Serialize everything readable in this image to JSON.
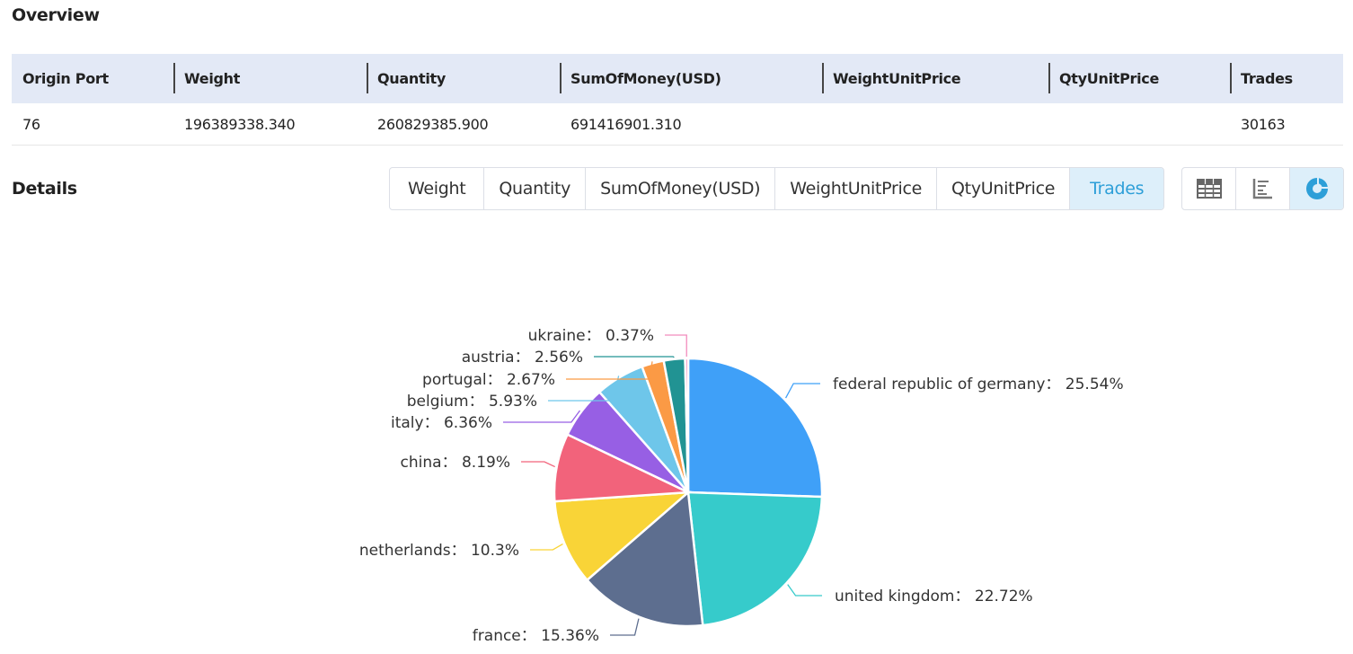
{
  "overview": {
    "title": "Overview",
    "columns": [
      "Origin Port",
      "Weight",
      "Quantity",
      "SumOfMoney(USD)",
      "WeightUnitPrice",
      "QtyUnitPrice",
      "Trades"
    ],
    "row": [
      "76",
      "196389338.340",
      "260829385.900",
      "691416901.310",
      "",
      "",
      "30163"
    ]
  },
  "details": {
    "title": "Details",
    "tabs": [
      {
        "label": "Weight",
        "active": false
      },
      {
        "label": "Quantity",
        "active": false
      },
      {
        "label": "SumOfMoney(USD)",
        "active": false
      },
      {
        "label": "WeightUnitPrice",
        "active": false
      },
      {
        "label": "QtyUnitPrice",
        "active": false
      },
      {
        "label": "Trades",
        "active": true
      }
    ],
    "views": [
      {
        "icon": "table-icon",
        "active": false
      },
      {
        "icon": "bar-chart-icon",
        "active": false
      },
      {
        "icon": "pie-chart-icon",
        "active": true
      }
    ]
  },
  "chart_data": {
    "type": "pie",
    "title": "",
    "label_separator": "：",
    "slices": [
      {
        "name": "federal republic of germany",
        "value": 25.54,
        "label": "25.54%",
        "color": "#3fa0f8"
      },
      {
        "name": "united kingdom",
        "value": 22.72,
        "label": "22.72%",
        "color": "#36cbcb"
      },
      {
        "name": "france",
        "value": 15.36,
        "label": "15.36%",
        "color": "#5d6e8f"
      },
      {
        "name": "netherlands",
        "value": 10.3,
        "label": "10.3%",
        "color": "#f9d437"
      },
      {
        "name": "china",
        "value": 8.19,
        "label": "8.19%",
        "color": "#f2637b"
      },
      {
        "name": "italy",
        "value": 6.36,
        "label": "6.36%",
        "color": "#975fe4"
      },
      {
        "name": "belgium",
        "value": 5.93,
        "label": "5.93%",
        "color": "#6ec6ea"
      },
      {
        "name": "portugal",
        "value": 2.67,
        "label": "2.67%",
        "color": "#fb9a45"
      },
      {
        "name": "austria",
        "value": 2.56,
        "label": "2.56%",
        "color": "#219393"
      },
      {
        "name": "ukraine",
        "value": 0.37,
        "label": "0.37%",
        "color": "#f28cbd"
      }
    ]
  }
}
